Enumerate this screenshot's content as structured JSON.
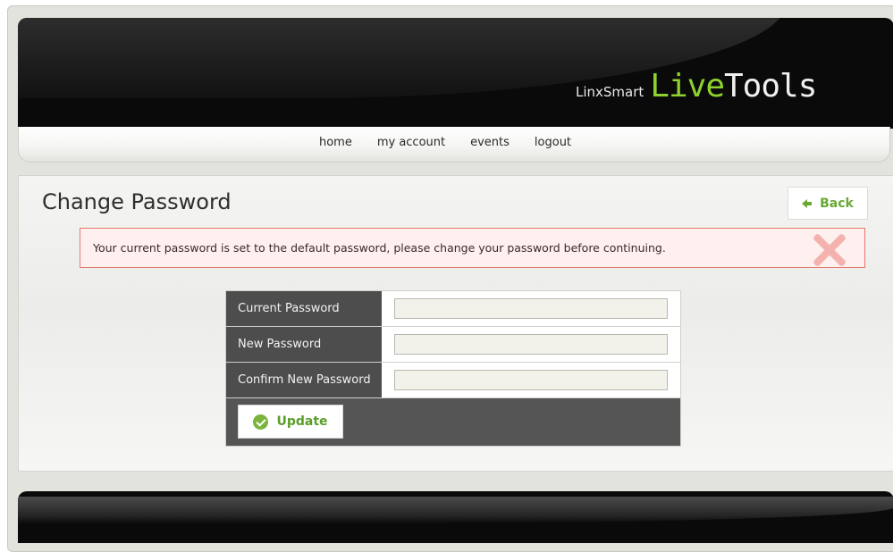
{
  "brand": {
    "prefix": "LinxSmart",
    "live": "Live",
    "tools": "Tools",
    "accent_color": "#8fd12d"
  },
  "nav": {
    "items": [
      {
        "label": "home"
      },
      {
        "label": "my account"
      },
      {
        "label": "events"
      },
      {
        "label": "logout"
      }
    ]
  },
  "page": {
    "title": "Change Password",
    "back_label": "Back",
    "back_icon": "arrow-left-icon"
  },
  "alert": {
    "message": "Your current password is set to the default password, please change your password before continuing.",
    "icon": "close-x-icon",
    "border_color": "#e37a70"
  },
  "form": {
    "fields": [
      {
        "label": "Current Password",
        "value": ""
      },
      {
        "label": "New Password",
        "value": ""
      },
      {
        "label": "Confirm New Password",
        "value": ""
      }
    ],
    "submit_label": "Update",
    "submit_icon": "check-circle-icon"
  }
}
